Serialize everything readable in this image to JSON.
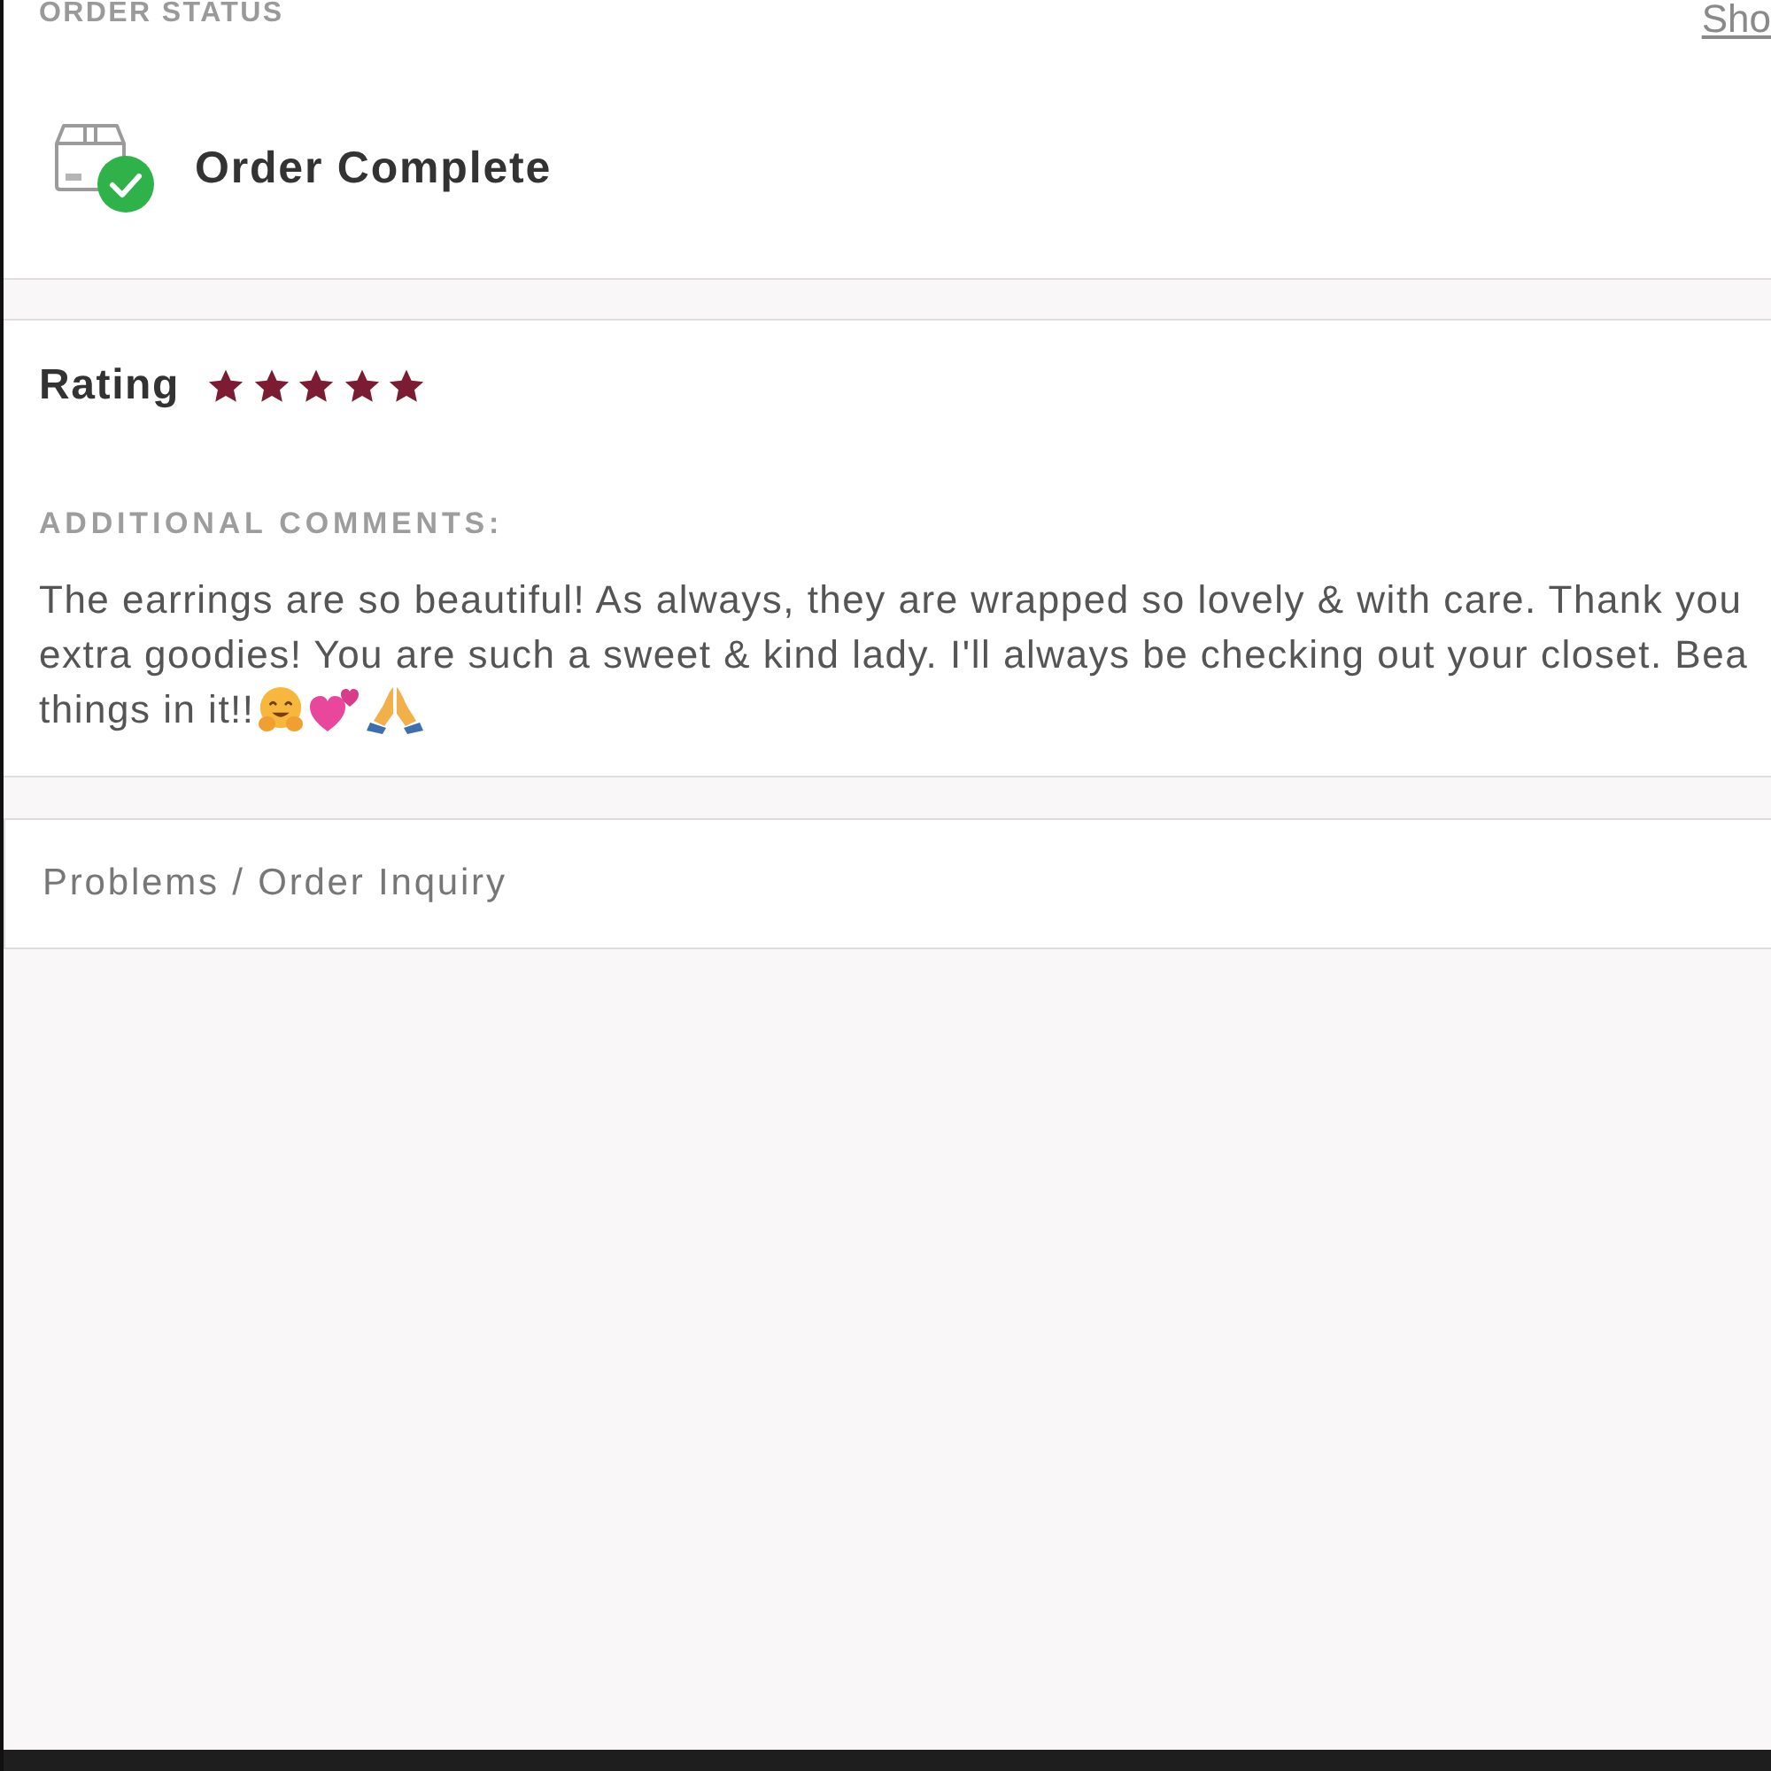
{
  "order_status": {
    "heading": "ORDER STATUS",
    "link": "Sho",
    "status": "Order Complete",
    "complete": true
  },
  "rating": {
    "label": "Rating",
    "stars": 5,
    "comments_heading": "ADDITIONAL COMMENTS:",
    "comment_lines": [
      "The earrings are so beautiful! As always, they are wrapped so lovely & with care. Thank you",
      "extra goodies! You are such a sweet & kind lady. I'll always be checking out your closet. Bea",
      "things in it!!"
    ],
    "emojis": [
      {
        "kind": "hugging"
      },
      {
        "kind": "hearts"
      },
      {
        "kind": "praying"
      }
    ]
  },
  "inquiry": {
    "label": "Problems / Order Inquiry"
  }
}
